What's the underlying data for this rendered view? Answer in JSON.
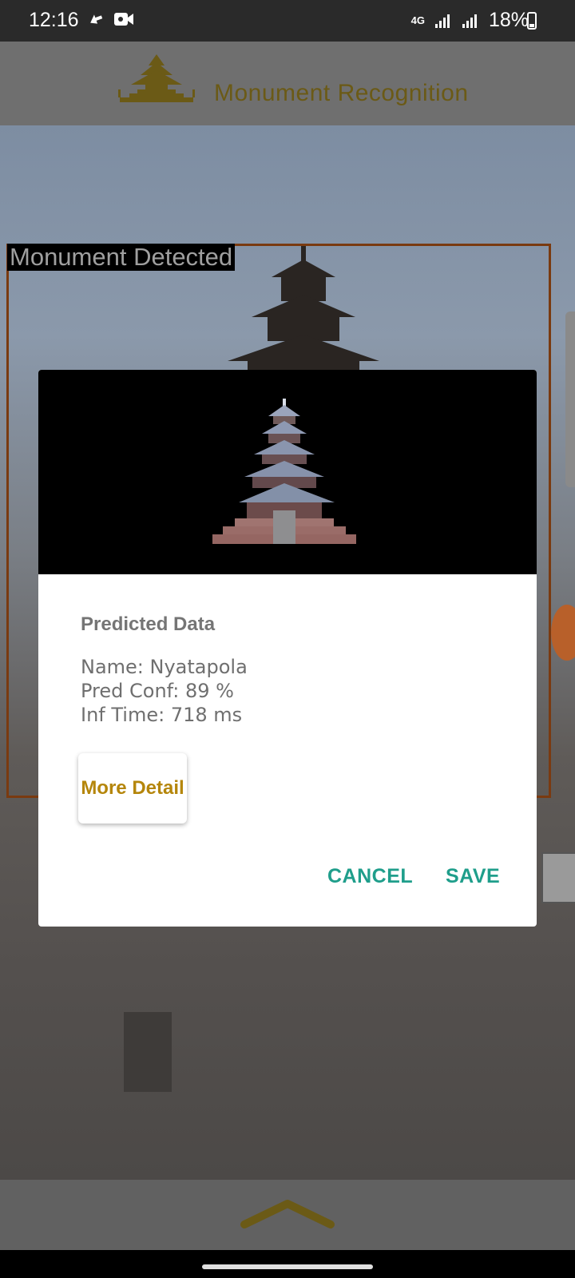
{
  "status_bar": {
    "time": "12:16",
    "network": "4G",
    "battery": "18%",
    "icons": [
      "transfer-icon",
      "video-icon",
      "signal-icon",
      "signal-icon",
      "battery-icon"
    ]
  },
  "app": {
    "title": "Monument Recognition",
    "logo_icon": "pagoda-logo-icon",
    "accent_color": "#b5860b"
  },
  "camera": {
    "detection_label": "Monument Detected",
    "box_color": "#c2541a"
  },
  "dialog": {
    "heading": "Predicted Data",
    "name_line": "Name: Nyatapola",
    "conf_line": "Pred Conf: 89 %",
    "time_line": "Inf Time: 718 ms",
    "more_button": "More Detail",
    "cancel_button": "CANCEL",
    "save_button": "SAVE",
    "action_color": "#1f9e8b"
  },
  "bottom": {
    "expand_icon": "chevron-up-icon"
  }
}
